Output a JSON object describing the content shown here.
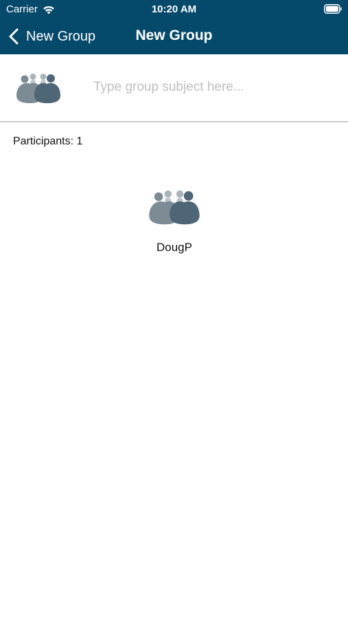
{
  "status_bar": {
    "carrier": "Carrier",
    "time": "10:20 AM",
    "wifi_icon": "wifi-icon",
    "battery_icon": "battery-icon"
  },
  "nav": {
    "back_label": "New Group",
    "title": "New Group",
    "background_color": "#064a6b"
  },
  "subject": {
    "placeholder": "Type group subject here...",
    "value": "",
    "avatar_icon": "group-avatar-icon"
  },
  "participants": {
    "label": "Participants: 1",
    "items": [
      {
        "name": "DougP",
        "avatar_icon": "group-avatar-icon"
      }
    ]
  }
}
